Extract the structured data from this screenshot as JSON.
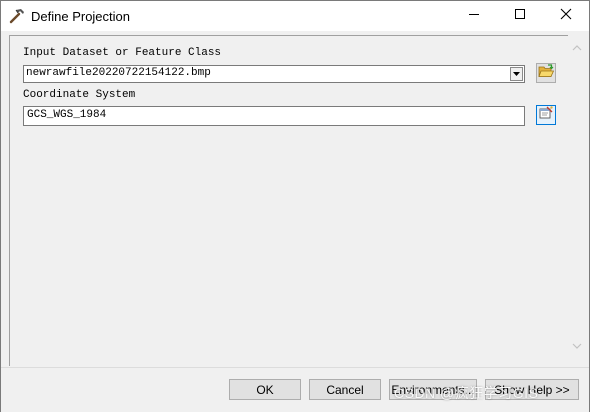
{
  "window": {
    "title": "Define Projection",
    "icon": "hammer-icon"
  },
  "caption": {
    "minimize_icon": "minimize-icon",
    "maximize_icon": "maximize-icon",
    "close_icon": "close-icon"
  },
  "form": {
    "input_label": "Input Dataset or Feature Class",
    "input_value": "newrawfile20220722154122.bmp",
    "coord_label": "Coordinate System",
    "coord_value": "GCS_WGS_1984",
    "browse_icon": "open-folder-icon",
    "properties_icon": "spatial-reference-properties-icon"
  },
  "buttons": {
    "ok": "OK",
    "cancel": "Cancel",
    "environments": "Environments...",
    "show_help": "Show Help >>"
  },
  "watermark": "CSDN @疯狂学习GIS"
}
